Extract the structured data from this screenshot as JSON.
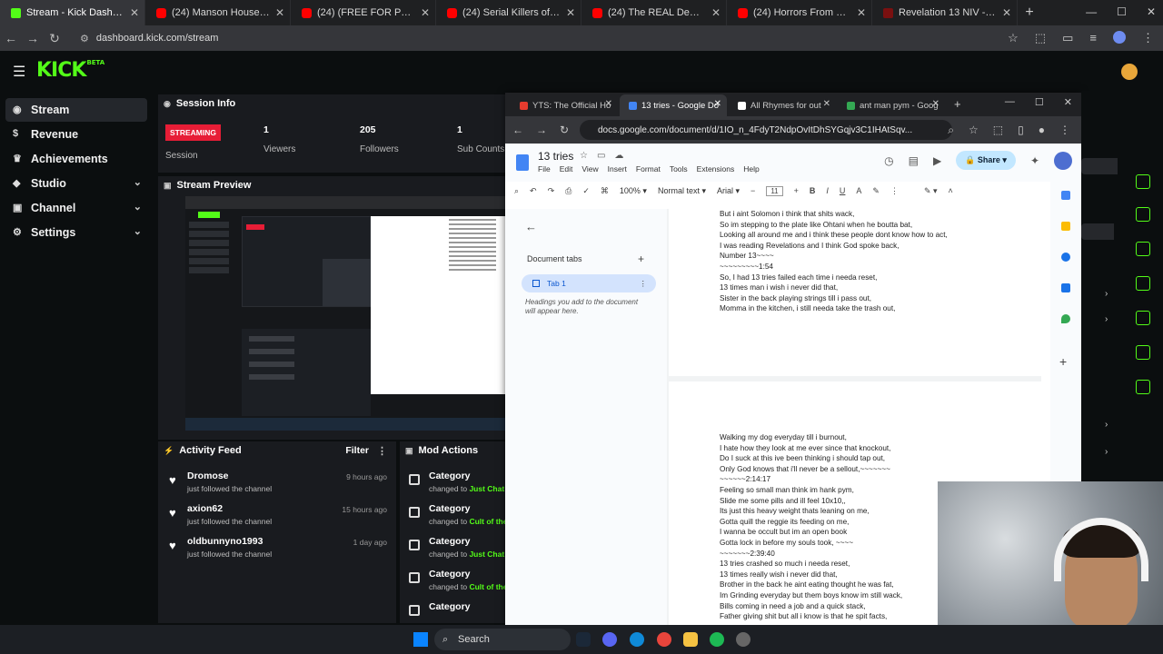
{
  "browser": {
    "tabs": [
      {
        "title": "Stream - Kick Dashboard",
        "icon": "kick",
        "active": true
      },
      {
        "title": "(24) Manson House, Medical Ex",
        "icon": "yt"
      },
      {
        "title": "(24) (FREE FOR PROFIT) 90s Bo",
        "icon": "yt"
      },
      {
        "title": "(24) Serial Killers of Ancient Eg",
        "icon": "yt"
      },
      {
        "title": "(24) The REAL Demon Hierarch",
        "icon": "yt"
      },
      {
        "title": "(24) Horrors From an FBI Datab",
        "icon": "yt"
      },
      {
        "title": "Revelation 13 NIV - The Beast",
        "icon": "bible"
      }
    ],
    "url": "dashboard.kick.com/stream"
  },
  "kick": {
    "logo": "KICK",
    "logo_sup": "BETA",
    "sidebar": [
      {
        "label": "Stream",
        "icon": "stream-icon",
        "active": true
      },
      {
        "label": "Revenue",
        "icon": "revenue-icon"
      },
      {
        "label": "Achievements",
        "icon": "trophy-icon"
      },
      {
        "label": "Studio",
        "icon": "studio-icon",
        "expand": true
      },
      {
        "label": "Channel",
        "icon": "channel-icon",
        "expand": true
      },
      {
        "label": "Settings",
        "icon": "gear-icon",
        "expand": true
      }
    ],
    "session": {
      "title": "Session Info",
      "status": "STREAMING",
      "session_label": "Session",
      "viewers": "1",
      "viewers_label": "Viewers",
      "followers": "205",
      "followers_label": "Followers",
      "subs": "1",
      "subs_label": "Sub Counts"
    },
    "preview": {
      "title": "Stream Preview"
    },
    "feed": {
      "title": "Activity Feed",
      "filter": "Filter",
      "items": [
        {
          "name": "Dromose",
          "sub": "just followed the channel",
          "time": "9 hours ago"
        },
        {
          "name": "axion62",
          "sub": "just followed the channel",
          "time": "15 hours ago"
        },
        {
          "name": "oldbunnyno1993",
          "sub": "just followed the channel",
          "time": "1 day ago"
        }
      ]
    },
    "mod": {
      "title": "Mod Actions",
      "items": [
        {
          "label": "Category",
          "prefix": "changed to ",
          "value": "Just Chat"
        },
        {
          "label": "Category",
          "prefix": "changed to ",
          "value": "Cult of the"
        },
        {
          "label": "Category",
          "prefix": "changed to ",
          "value": "Just Chat"
        },
        {
          "label": "Category",
          "prefix": "changed to ",
          "value": "Cult of the"
        },
        {
          "label": "Category",
          "prefix": "",
          "value": ""
        }
      ]
    }
  },
  "gdocs_window": {
    "tabs": [
      {
        "title": "YTS: The Official Ho",
        "color": "#e63b2e"
      },
      {
        "title": "13 tries - Google Do",
        "color": "#4285f4",
        "active": true
      },
      {
        "title": "All Rhymes for out",
        "color": "#ffffff"
      },
      {
        "title": "ant man pym - Goog",
        "color": "#34a853"
      }
    ],
    "url": "docs.google.com/document/d/1IO_n_4FdyT2NdpOvItDhSYGqjv3C1IHAtSqv...",
    "doc_title": "13 tries",
    "menu": [
      "File",
      "Edit",
      "View",
      "Insert",
      "Format",
      "Tools",
      "Extensions",
      "Help"
    ],
    "share": "Share",
    "zoom": "100%",
    "style": "Normal text",
    "font": "Arial",
    "font_size": "11",
    "outline": {
      "header": "Document tabs",
      "tab": "Tab 1",
      "hint": "Headings you add to the document will appear here."
    },
    "page1_lines": [
      "But i aint Solomon i think that shits wack,",
      "So im stepping to the plate like Ohtani when he boutta bat,",
      "Looking all around me and i think these people dont know how to act,",
      "I was reading Revelations and I think God spoke back,",
      "Number 13~~~~",
      "~~~~~~~~~1:54",
      "So, I had 13 tries failed each time i needa reset,",
      "13 times man i wish i never did that,",
      "Sister in the back playing strings till i pass out,",
      "Momma in the kitchen, i still needa take the trash out,"
    ],
    "page2_lines": [
      "Walking my dog everyday till i burnout,",
      "I hate how they look at me ever since that knockout,",
      "Do I suck at this ive been thinking i should tap out,",
      "Only God knows that i'll never be a sellout,~~~~~~~",
      "~~~~~~2:14:17",
      "Feeling so small man think im hank pym,",
      "Slide me some pills and ill feel 10x10,,",
      "Its just this heavy weight thats leaning on me,",
      "Gotta quill the reggie its feeding on me,",
      "I wanna be occult but im an open book",
      "Gotta lock in before my souls took, ~~~~",
      "~~~~~~~2:39:40",
      "13 tries crashed so much i needa reset,",
      "13 times really wish i never did that,",
      "Brother in the back he aint eating thought he was fat,",
      "Im Grinding everyday but them boys know im still wack,",
      "Bills coming in need a job and a quick stack,",
      "Father giving shit but all i know is that he spit facts,"
    ]
  },
  "taskbar": {
    "search": "Search"
  }
}
